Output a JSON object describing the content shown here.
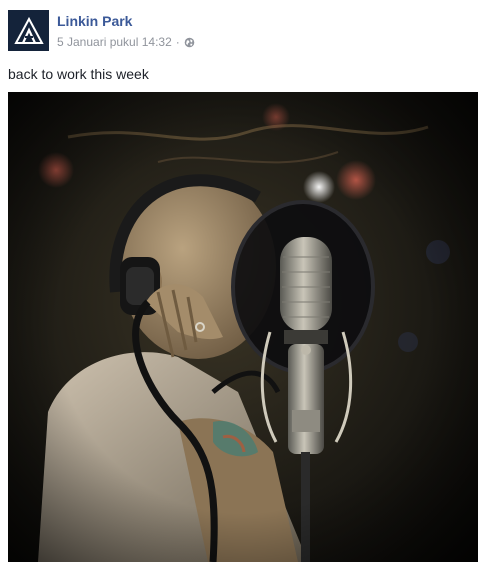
{
  "post": {
    "author": "Linkin Park",
    "timestamp": "5 Januari pukul 14:32",
    "separator": "·",
    "privacy_icon": "globe-icon",
    "avatar_icon": "linkin-park-logo-icon",
    "text": "back to work this week",
    "photo_subject": "singer-with-headphones-at-studio-microphone"
  },
  "colors": {
    "name_link": "#3b5998",
    "meta_text": "#90949c",
    "avatar_bg": "#14233a"
  }
}
